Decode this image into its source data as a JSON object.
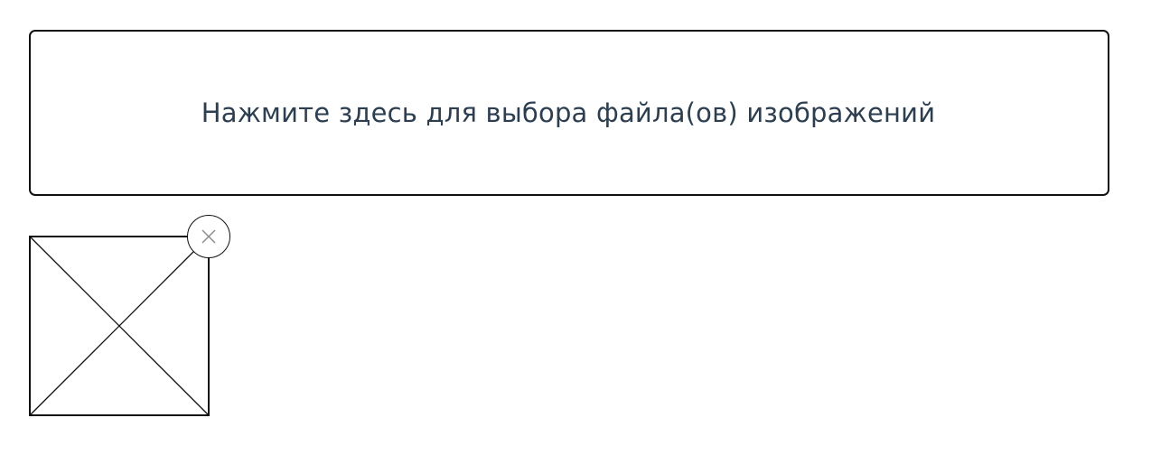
{
  "upload": {
    "prompt": "Нажмите здесь для выбора файла(ов) изображений"
  },
  "preview": {
    "image_icon": "broken-image-placeholder-icon",
    "remove_icon": "close-icon"
  },
  "colors": {
    "text": "#2c3e50",
    "border": "#111111",
    "remove_icon": "#8a8a8a"
  }
}
